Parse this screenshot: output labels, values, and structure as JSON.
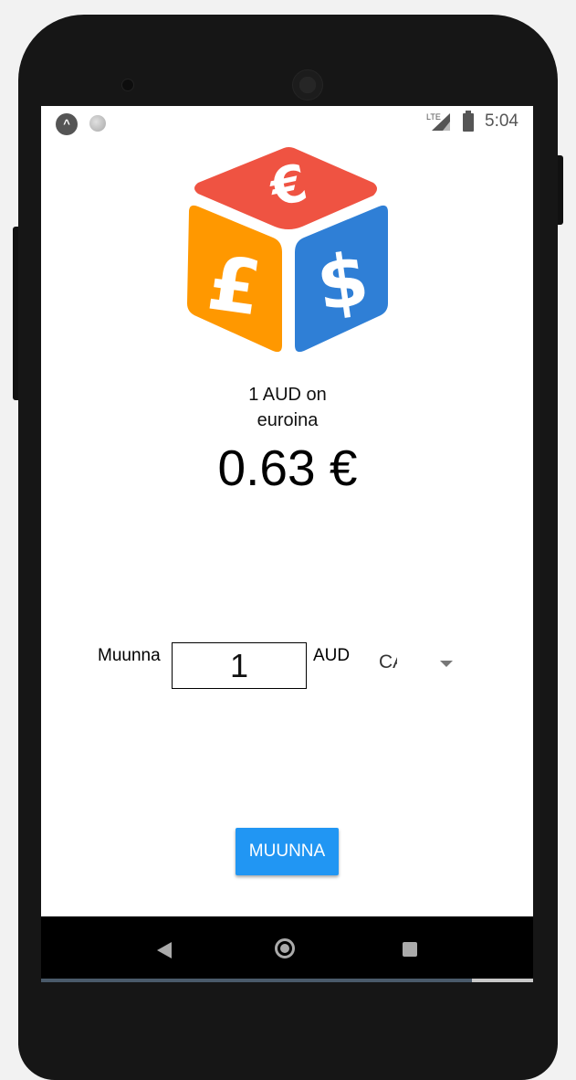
{
  "status_bar": {
    "network_label": "LTE",
    "time": "5:04",
    "app_icon": "expo-icon",
    "notification_icon": "dot-icon"
  },
  "logo": {
    "symbols": [
      "€",
      "£",
      "$"
    ],
    "colors": {
      "top": "#ef5342",
      "left": "#ff9800",
      "right": "#2f7fd6"
    }
  },
  "rate": {
    "label_line1": "1 AUD on",
    "label_line2": "euroina",
    "value": "0.63 €"
  },
  "converter": {
    "label": "Muunna",
    "amount": "1",
    "from_currency": "AUD",
    "to_currency": "CAD"
  },
  "button": {
    "label": "MUUNNA",
    "color": "#2196f3"
  },
  "nav": {
    "icons": [
      "back-icon",
      "home-icon",
      "recents-icon"
    ]
  }
}
